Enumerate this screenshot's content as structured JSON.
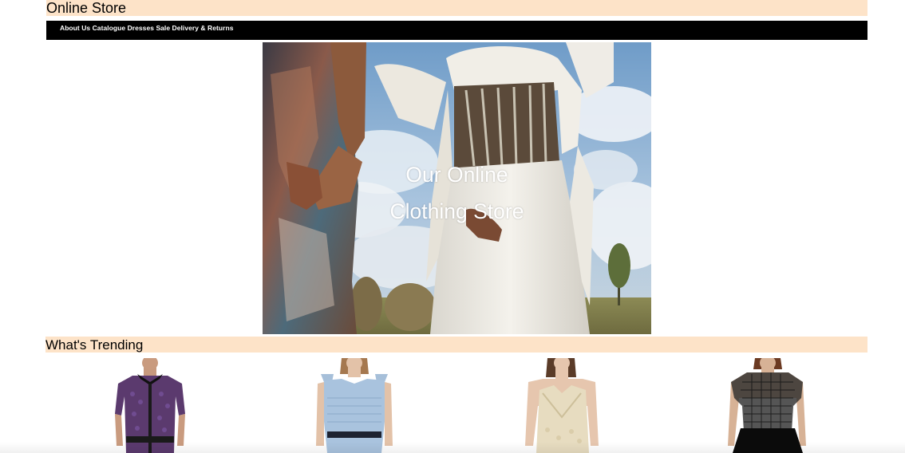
{
  "header": {
    "site_title": "Online Store"
  },
  "nav": {
    "items": [
      {
        "label": "About Us"
      },
      {
        "label": "Catalogue"
      },
      {
        "label": "Dresses"
      },
      {
        "label": "Sale"
      },
      {
        "label": "Delivery & Returns"
      }
    ]
  },
  "hero": {
    "line1": "Our Online",
    "line2": "Clothing Store"
  },
  "trending": {
    "title": "What's Trending"
  },
  "products": [
    {
      "name": "purple-lace-dress"
    },
    {
      "name": "light-blue-lace-dress"
    },
    {
      "name": "cream-lace-dress"
    },
    {
      "name": "black-lace-dress"
    }
  ],
  "colors": {
    "header_bg": "#fde3c8",
    "nav_bg": "#000000",
    "nav_text": "#ffffff"
  }
}
